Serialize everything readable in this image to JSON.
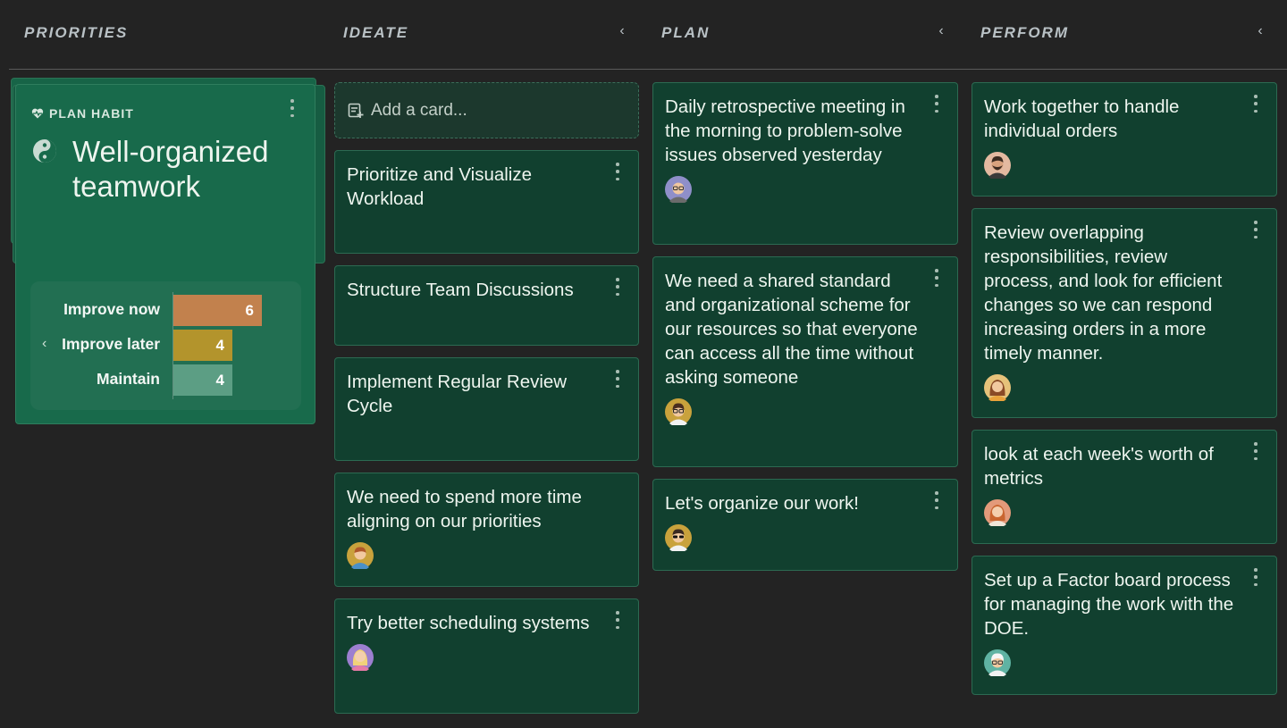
{
  "columns": {
    "priorities": {
      "title": "PRIORITIES"
    },
    "ideate": {
      "title": "IDEATE",
      "add_card": "Add a card..."
    },
    "plan": {
      "title": "PLAN"
    },
    "perform": {
      "title": "PERFORM"
    }
  },
  "habit": {
    "type_label": "PLAN HABIT",
    "title": "Well-organized teamwork",
    "scores": [
      {
        "label": "Improve now",
        "value": 6,
        "color": "#c2814d"
      },
      {
        "label": "Improve later",
        "value": 4,
        "color": "#b3942c"
      },
      {
        "label": "Maintain",
        "value": 4,
        "color": "#5c9e84"
      }
    ]
  },
  "ideate_cards": [
    {
      "text": "Prioritize and Visualize Workload",
      "avatar": null
    },
    {
      "text": "Structure Team Discussions",
      "avatar": null
    },
    {
      "text": "Implement Regular Review Cycle",
      "avatar": null
    },
    {
      "text": "We need to spend more time aligning on our priorities",
      "avatar": "man-orange-shirt"
    },
    {
      "text": "Try better scheduling systems",
      "avatar": "woman-blonde"
    }
  ],
  "plan_cards": [
    {
      "text": "Daily retrospective meeting in the morning to problem-solve issues observed yesterday",
      "avatar": "man-glasses-bald"
    },
    {
      "text": "We need a shared standard and organizational scheme for our resources so that everyone can access all the time without asking someone",
      "avatar": "man-glasses-dark-hair"
    },
    {
      "text": "Let's organize our work!",
      "avatar": "man-sunglasses"
    }
  ],
  "perform_cards": [
    {
      "text": "Work together to handle individual orders",
      "avatar": "man-beard"
    },
    {
      "text": "Review overlapping responsibilities, review process, and look for efficient changes so we can respond increasing orders in a more timely manner.",
      "avatar": "woman-brown-hair"
    },
    {
      "text": "look at each week's worth of metrics",
      "avatar": "woman-red-hair"
    },
    {
      "text": "Set up a Factor board process for managing the work with the DOE.",
      "avatar": "man-white-hair"
    }
  ]
}
